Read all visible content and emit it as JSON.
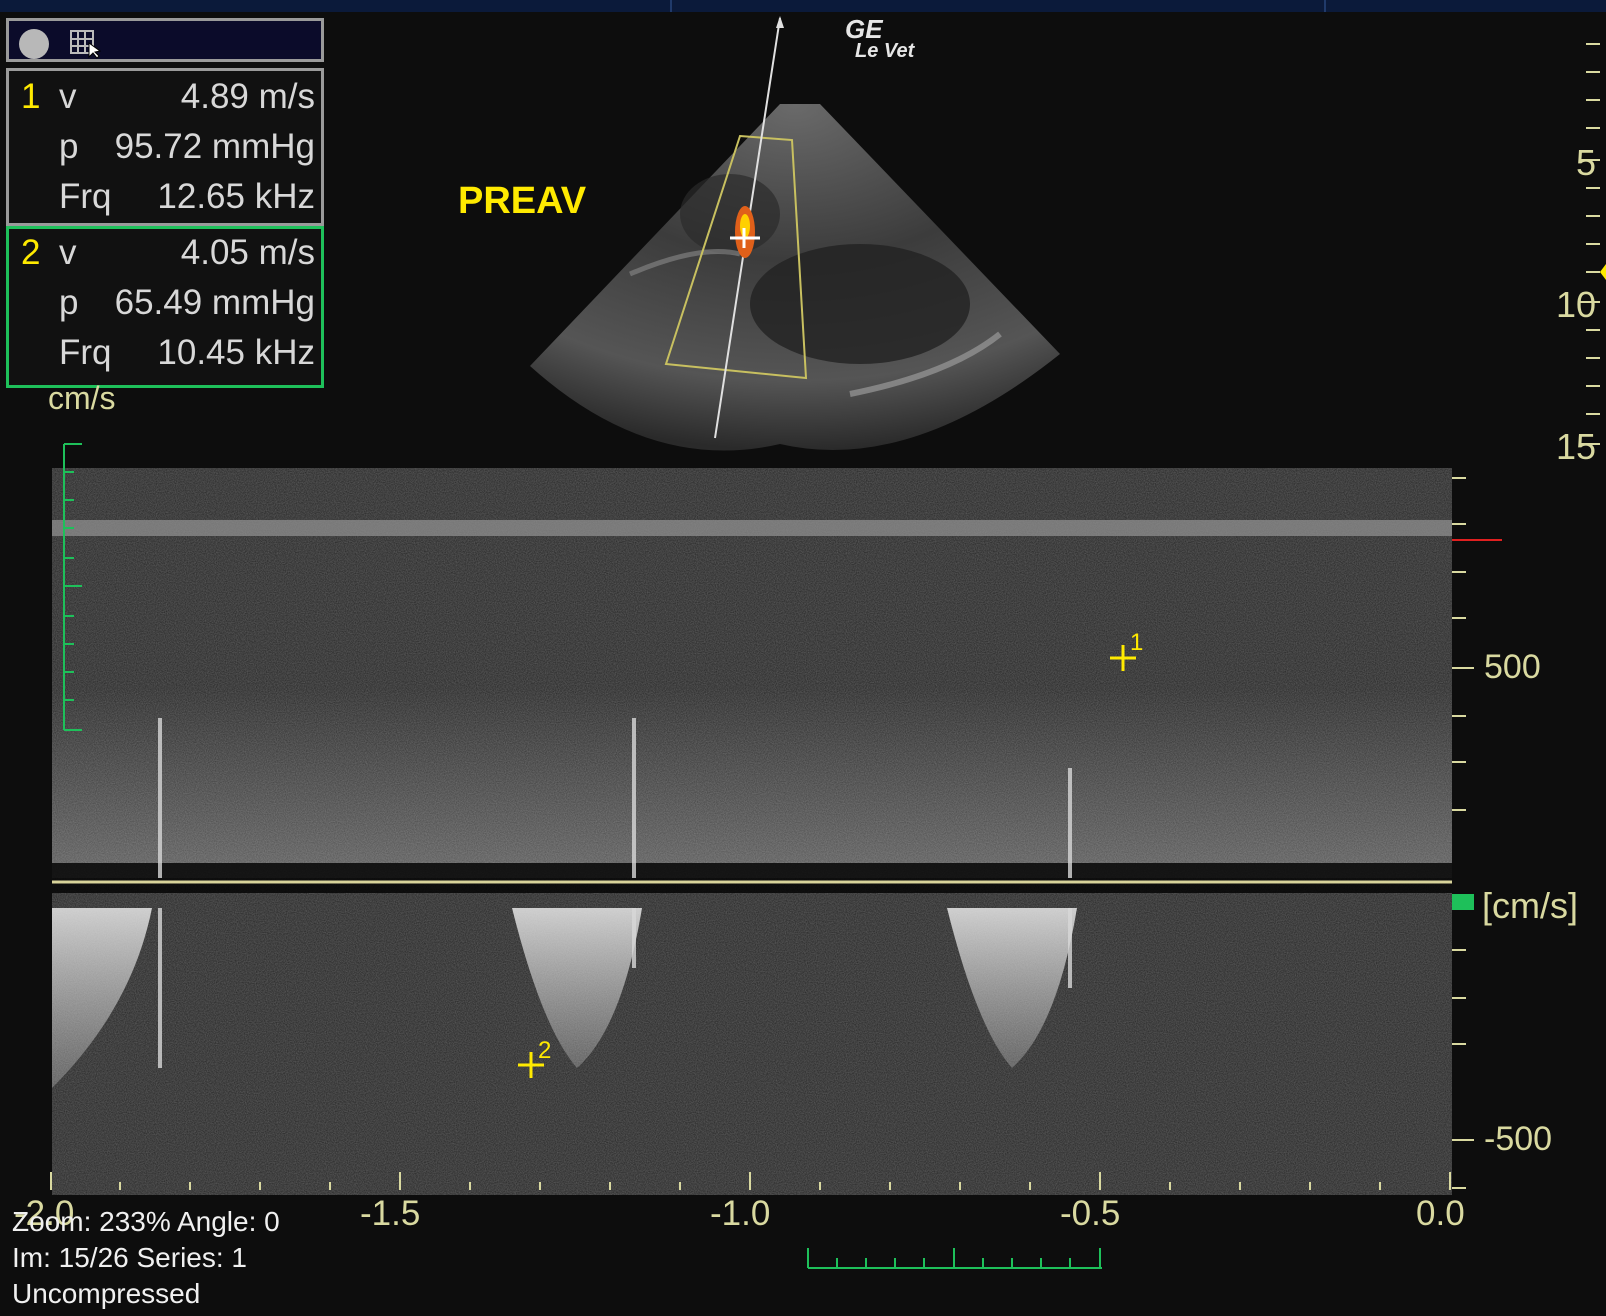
{
  "measurements": [
    {
      "index": "1",
      "v_label": "v",
      "v_value": "4.89 m/s",
      "p_label": "p",
      "p_value": "95.72 mmHg",
      "frq_label": "Frq",
      "frq_value": "12.65 kHz"
    },
    {
      "index": "2",
      "v_label": "v",
      "v_value": "4.05 m/s",
      "p_label": "p",
      "p_value": "65.49 mmHg",
      "frq_label": "Frq",
      "frq_value": "10.45 kHz"
    }
  ],
  "unit_label": "cm/s",
  "view_label": "PREAV",
  "logo": {
    "line1": "GE",
    "line2": "Le Vet"
  },
  "depth_scale": [
    "5",
    "10",
    "15"
  ],
  "velocity_scale": {
    "pos": "500",
    "neg": "-500",
    "unit": "[cm/s]"
  },
  "time_axis": [
    "-2.0",
    "-1.5",
    "-1.0",
    "-0.5",
    "0.0"
  ],
  "markers": [
    {
      "label": "1"
    },
    {
      "label": "2"
    }
  ],
  "status": {
    "zoom": "Zoom: 233% Angle: 0",
    "image": "Im: 15/26   Series:  1",
    "compression": "Uncompressed"
  },
  "colors": {
    "accent_yellow": "#ffea00",
    "active_green": "#1ec05a",
    "scale_text": "#d9d9a0"
  }
}
